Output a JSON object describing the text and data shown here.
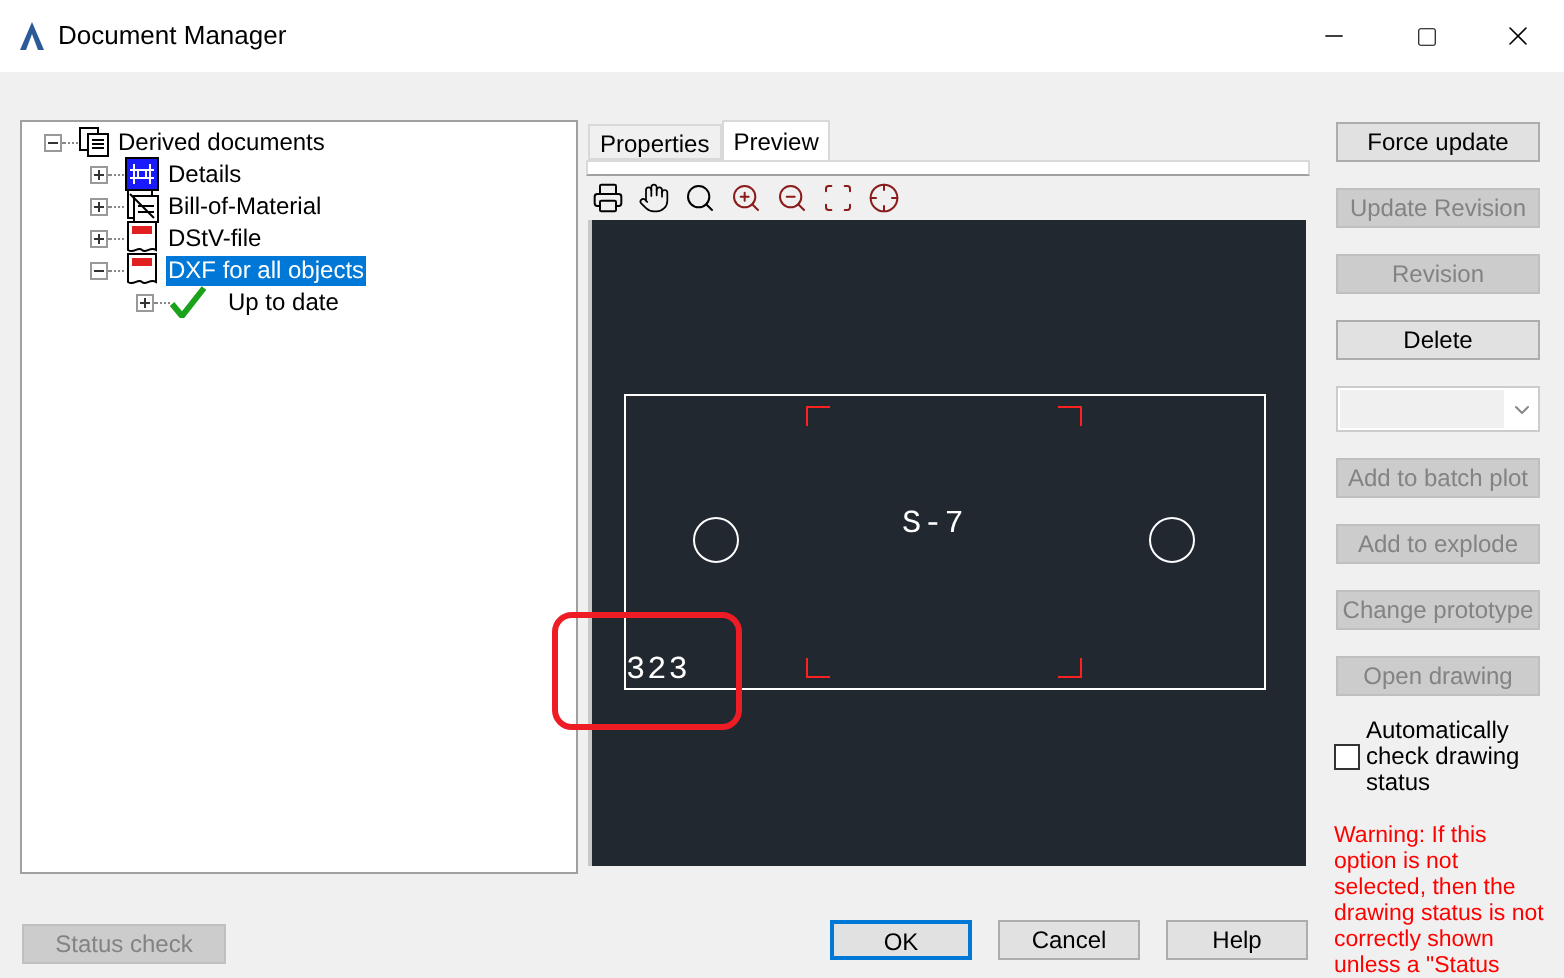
{
  "window": {
    "title": "Document Manager"
  },
  "tree": [
    {
      "label": "Derived documents",
      "kind": "documents",
      "expanded": true,
      "selected": false,
      "children": [
        {
          "label": "Details",
          "kind": "details",
          "expanded": false,
          "selected": false
        },
        {
          "label": "Bill-of-Material",
          "kind": "bom",
          "expanded": false,
          "selected": false
        },
        {
          "label": "DStV-file",
          "kind": "doc",
          "expanded": false,
          "selected": false
        },
        {
          "label": "DXF for all objects",
          "kind": "doc",
          "expanded": true,
          "selected": true,
          "children": [
            {
              "label": "Up to date",
              "kind": "check",
              "expanded": false,
              "selected": false
            }
          ]
        }
      ]
    }
  ],
  "tabs": [
    {
      "label": "Properties",
      "selected": false
    },
    {
      "label": "Preview",
      "selected": true
    }
  ],
  "preview": {
    "part_label": "S-7",
    "dimension": "323"
  },
  "side_controls": [
    {
      "kind": "button",
      "label": "Force update",
      "disabled": false
    },
    {
      "kind": "button",
      "label": "Update Revision",
      "disabled": true
    },
    {
      "kind": "button",
      "label": "Revision",
      "disabled": true
    },
    {
      "kind": "button",
      "label": "Delete",
      "disabled": false
    },
    {
      "kind": "dropdown",
      "disabled": true
    },
    {
      "kind": "button",
      "label": "Add to batch plot",
      "disabled": true
    },
    {
      "kind": "button",
      "label": "Add to explode",
      "disabled": true
    },
    {
      "kind": "button",
      "label": "Change prototype",
      "disabled": true
    },
    {
      "kind": "button",
      "label": "Open drawing",
      "disabled": true
    }
  ],
  "auto_check": {
    "label": "Automatically check drawing status",
    "checked": false
  },
  "warning": "Warning: If this option is not selected, then the drawing status is not correctly shown unless a \"Status",
  "status_button": {
    "label": "Status check",
    "disabled": true
  },
  "dialog_buttons": [
    {
      "label": "OK",
      "default": true
    },
    {
      "label": "Cancel",
      "default": false
    },
    {
      "label": "Help",
      "default": false
    }
  ]
}
